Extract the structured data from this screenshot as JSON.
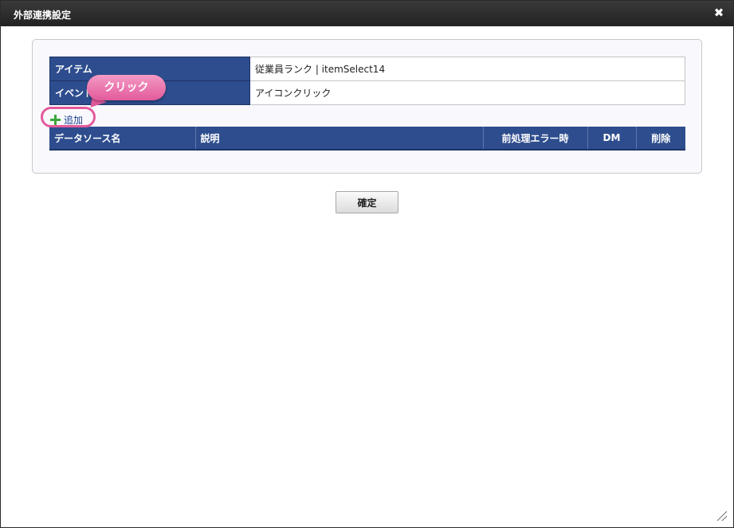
{
  "dialog": {
    "title": "外部連携設定",
    "close_label": "✖"
  },
  "info_table": {
    "rows": [
      {
        "label": "アイテム",
        "value": "従業員ランク | itemSelect14"
      },
      {
        "label": "イベント",
        "value": "アイコンクリック"
      }
    ]
  },
  "add_link": {
    "icon": "plus-icon",
    "label": "追加"
  },
  "datasource_table": {
    "headers": [
      "データソース名",
      "説明",
      "前処理エラー時",
      "DM",
      "削除"
    ]
  },
  "confirm_button": {
    "label": "確定"
  },
  "callout": {
    "label": "クリック"
  },
  "colors": {
    "header_blue": "#2e4d8e",
    "callout_pink": "#e25a9b",
    "add_icon_green": "#3aa83a"
  }
}
